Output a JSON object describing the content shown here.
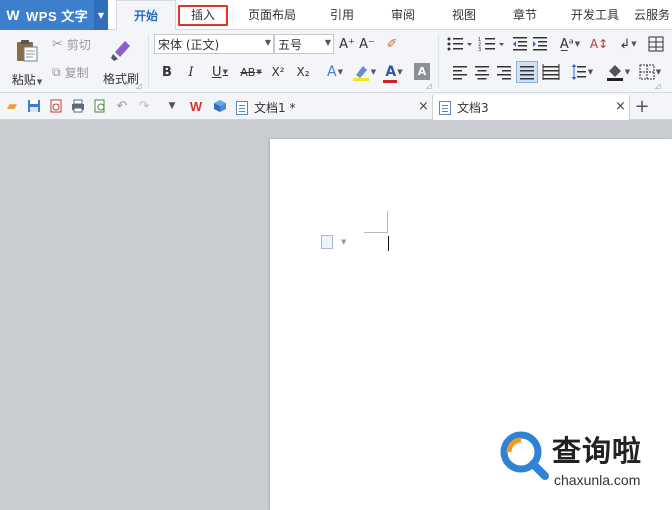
{
  "app": {
    "name": "WPS 文字",
    "logo": "W"
  },
  "menu": {
    "tabs": [
      {
        "label": "开始",
        "active": true
      },
      {
        "label": "插入",
        "highlighted": true
      },
      {
        "label": "页面布局"
      },
      {
        "label": "引用"
      },
      {
        "label": "审阅"
      },
      {
        "label": "视图"
      },
      {
        "label": "章节"
      },
      {
        "label": "开发工具"
      },
      {
        "label": "云服务"
      }
    ]
  },
  "ribbon": {
    "paste_label": "粘贴",
    "cut_label": "剪切",
    "copy_label": "复制",
    "format_painter_label": "格式刷",
    "font_name": "宋体 (正文)",
    "font_size": "五号",
    "bold": "B",
    "italic": "I",
    "underline": "U",
    "strike": "AB",
    "superscript": "X²",
    "subscript": "X₂",
    "grow_font": "A⁺",
    "shrink_font": "A⁻"
  },
  "documents": {
    "tabs": [
      {
        "label": "文档1 *",
        "active": false
      },
      {
        "label": "文档3",
        "active": true
      }
    ],
    "new_tab": "+"
  },
  "watermark": {
    "brand": "查询啦",
    "url": "chaxunla.com"
  },
  "colors": {
    "accent": "#3b7fcd",
    "highlight_border": "#e0322b",
    "watermark_orange": "#f39a1e",
    "watermark_blue": "#2f83d6"
  }
}
